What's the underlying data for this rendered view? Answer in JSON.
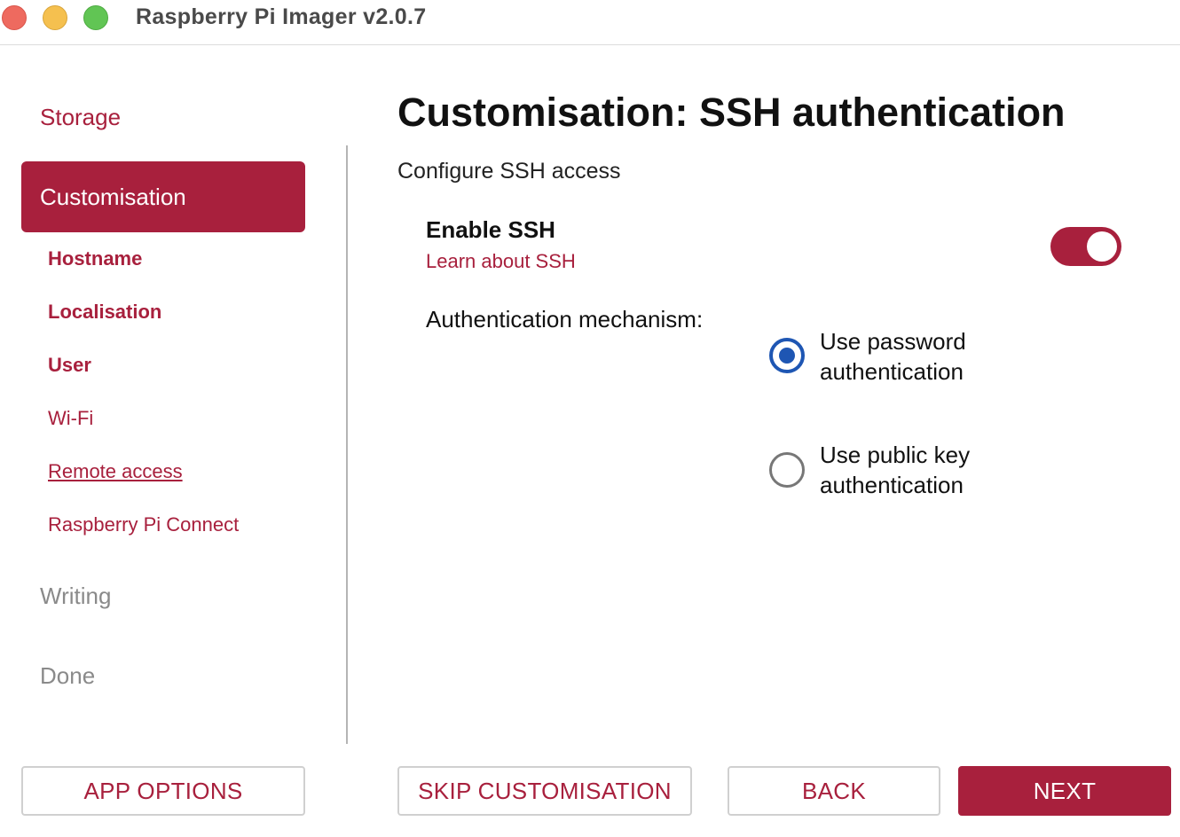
{
  "window": {
    "title": "Raspberry Pi Imager v2.0.7"
  },
  "sidebar": {
    "steps": {
      "storage": "Storage",
      "customisation": "Customisation",
      "writing": "Writing",
      "done": "Done"
    },
    "substeps": [
      {
        "label": "Hostname"
      },
      {
        "label": "Localisation"
      },
      {
        "label": "User"
      },
      {
        "label": "Wi-Fi"
      },
      {
        "label": "Remote access"
      },
      {
        "label": "Raspberry Pi Connect"
      }
    ]
  },
  "main": {
    "title": "Customisation: SSH authentication",
    "subtitle": "Configure SSH access",
    "enable_ssh": {
      "label": "Enable SSH",
      "link": "Learn about SSH",
      "enabled": true
    },
    "auth": {
      "label": "Authentication mechanism:",
      "options": [
        {
          "line1": "Use password",
          "line2": "authentication",
          "selected": true
        },
        {
          "line1": "Use public key",
          "line2": "authentication",
          "selected": false
        }
      ]
    }
  },
  "footer": {
    "app_options": "APP OPTIONS",
    "skip": "SKIP CUSTOMISATION",
    "back": "BACK",
    "next": "NEXT"
  },
  "colors": {
    "accent": "#a8203d",
    "radio_selected": "#1e56b3"
  }
}
